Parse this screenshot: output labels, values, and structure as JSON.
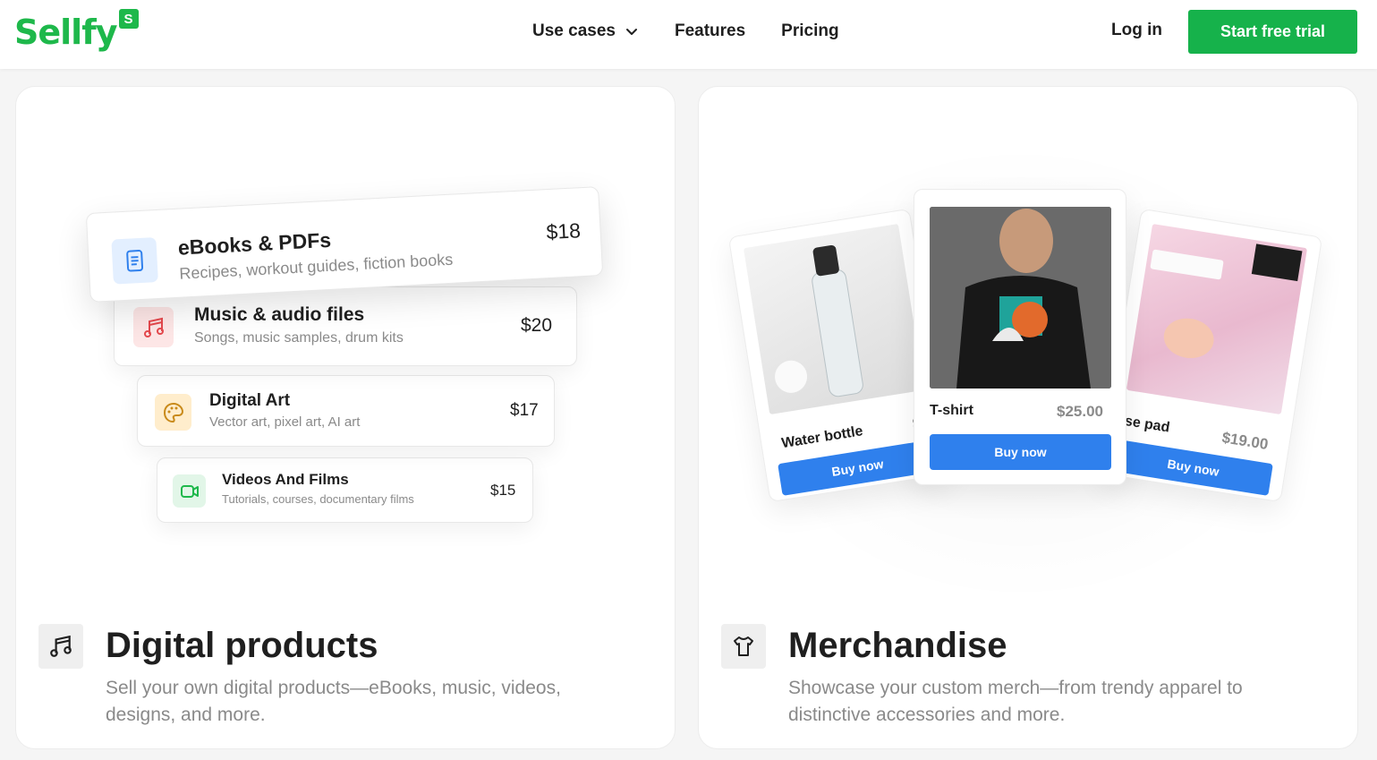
{
  "header": {
    "logo_text": "Sellfy",
    "logo_badge": "S",
    "nav": [
      {
        "label": "Use cases"
      },
      {
        "label": "Features"
      },
      {
        "label": "Pricing"
      }
    ],
    "login": "Log in",
    "cta": "Start free trial"
  },
  "digital": {
    "title": "Digital products",
    "description": "Sell your own digital products—eBooks, music, videos, designs, and more.",
    "icon": "music-notes-icon",
    "products": [
      {
        "name": "eBooks & PDFs",
        "sub": "Recipes, workout guides, fiction books",
        "price": "$18",
        "icon": "book-icon"
      },
      {
        "name": "Music & audio files",
        "sub": "Songs, music samples, drum kits",
        "price": "$20",
        "icon": "music-notes-icon"
      },
      {
        "name": "Digital Art",
        "sub": "Vector art, pixel art, AI art",
        "price": "$17",
        "icon": "palette-icon"
      },
      {
        "name": "Videos And Films",
        "sub": "Tutorials, courses, documentary films",
        "price": "$15",
        "icon": "video-icon"
      }
    ]
  },
  "merch": {
    "title": "Merchandise",
    "description": "Showcase your custom merch—from trendy apparel to distinctive accessories and more.",
    "icon": "tshirt-icon",
    "items": [
      {
        "name": "Water bottle",
        "price": "$",
        "buy": "Buy now"
      },
      {
        "name": "T-shirt",
        "price": "$25.00",
        "buy": "Buy now"
      },
      {
        "name": "use pad",
        "price": "$19.00",
        "buy": "Buy now"
      }
    ]
  },
  "colors": {
    "brand_green": "#16b24b",
    "buy_blue": "#2f80ed"
  }
}
